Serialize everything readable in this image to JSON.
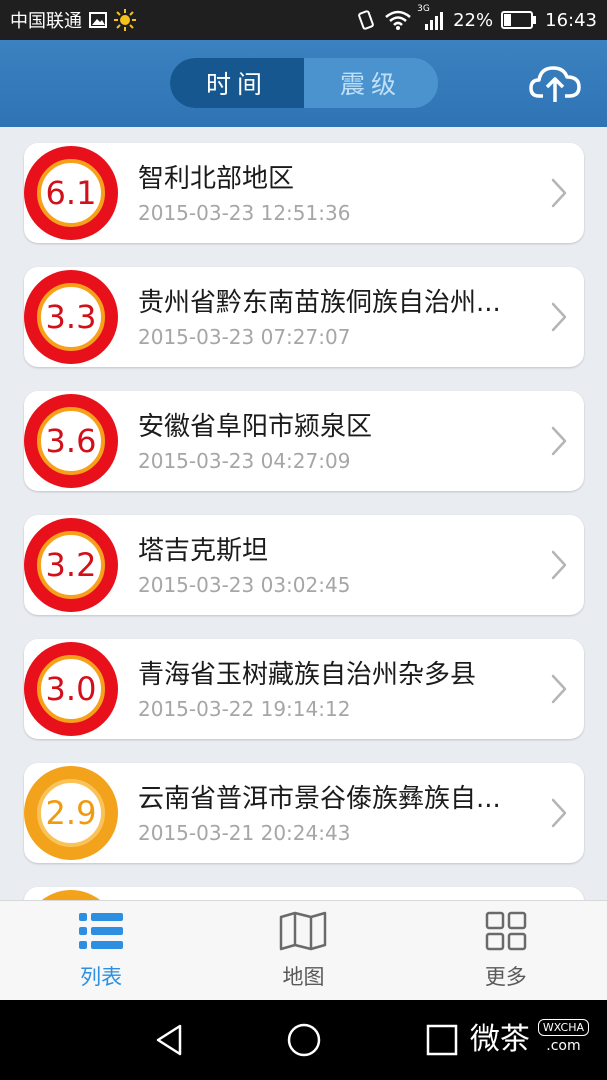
{
  "status_bar": {
    "carrier": "中国联通",
    "battery": "22%",
    "time": "16:43",
    "network": "3G",
    "icons": [
      "image-icon",
      "sun-icon",
      "vibrate-icon",
      "wifi-icon",
      "signal-icon",
      "battery-icon"
    ]
  },
  "header": {
    "tabs": [
      {
        "label": "时间",
        "active": true
      },
      {
        "label": "震级",
        "active": false
      }
    ],
    "upload_icon": "cloud-upload-icon"
  },
  "quakes": [
    {
      "magnitude": "6.1",
      "place": "智利北部地区",
      "time": "2015-03-23 12:51:36",
      "level": "red"
    },
    {
      "magnitude": "3.3",
      "place": "贵州省黔东南苗族侗族自治州...",
      "time": "2015-03-23 07:27:07",
      "level": "red"
    },
    {
      "magnitude": "3.6",
      "place": "安徽省阜阳市颍泉区",
      "time": "2015-03-23 04:27:09",
      "level": "red"
    },
    {
      "magnitude": "3.2",
      "place": "塔吉克斯坦",
      "time": "2015-03-23 03:02:45",
      "level": "red"
    },
    {
      "magnitude": "3.0",
      "place": "青海省玉树藏族自治州杂多县",
      "time": "2015-03-22 19:14:12",
      "level": "red"
    },
    {
      "magnitude": "2.9",
      "place": "云南省普洱市景谷傣族彝族自...",
      "time": "2015-03-21 20:24:43",
      "level": "orange"
    },
    {
      "magnitude": "",
      "place": "",
      "time": "",
      "level": "orange"
    }
  ],
  "tabbar": [
    {
      "label": "列表",
      "icon": "list-icon",
      "active": true
    },
    {
      "label": "地图",
      "icon": "map-icon",
      "active": false
    },
    {
      "label": "更多",
      "icon": "grid-icon",
      "active": false
    }
  ],
  "colors": {
    "header": "#3b82c0",
    "active_segment": "#16578f",
    "badge_red": "#e8101a",
    "badge_orange": "#f3a21b",
    "tab_active": "#2e8fe0"
  },
  "watermark": {
    "text": "微茶",
    "badge": "WXCHA",
    "domain": ".com"
  }
}
